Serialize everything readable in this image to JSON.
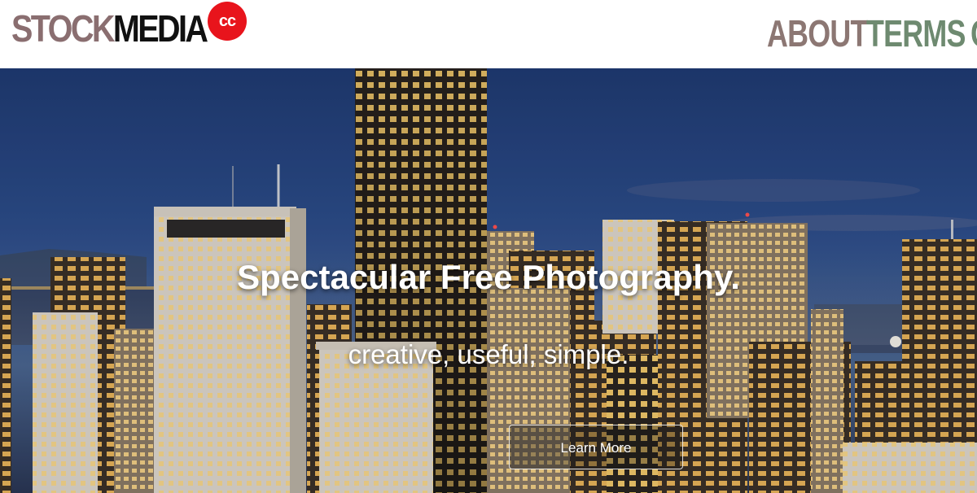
{
  "header": {
    "logo": {
      "part1": "STOCK",
      "part2": "MEDIA",
      "badge": "cc"
    },
    "nav": [
      {
        "label": "ABOUT"
      },
      {
        "label": "TERMS"
      },
      {
        "label": "C"
      }
    ]
  },
  "hero": {
    "title": "Spectacular Free Photography.",
    "subtitle": "creative, useful, simple.",
    "cta_label": "Learn More"
  },
  "colors": {
    "logo_stock": "#8a6e70",
    "logo_media": "#111111",
    "logo_badge": "#e8141c",
    "nav_about": "#8c7773",
    "nav_terms": "#6e8a70"
  }
}
